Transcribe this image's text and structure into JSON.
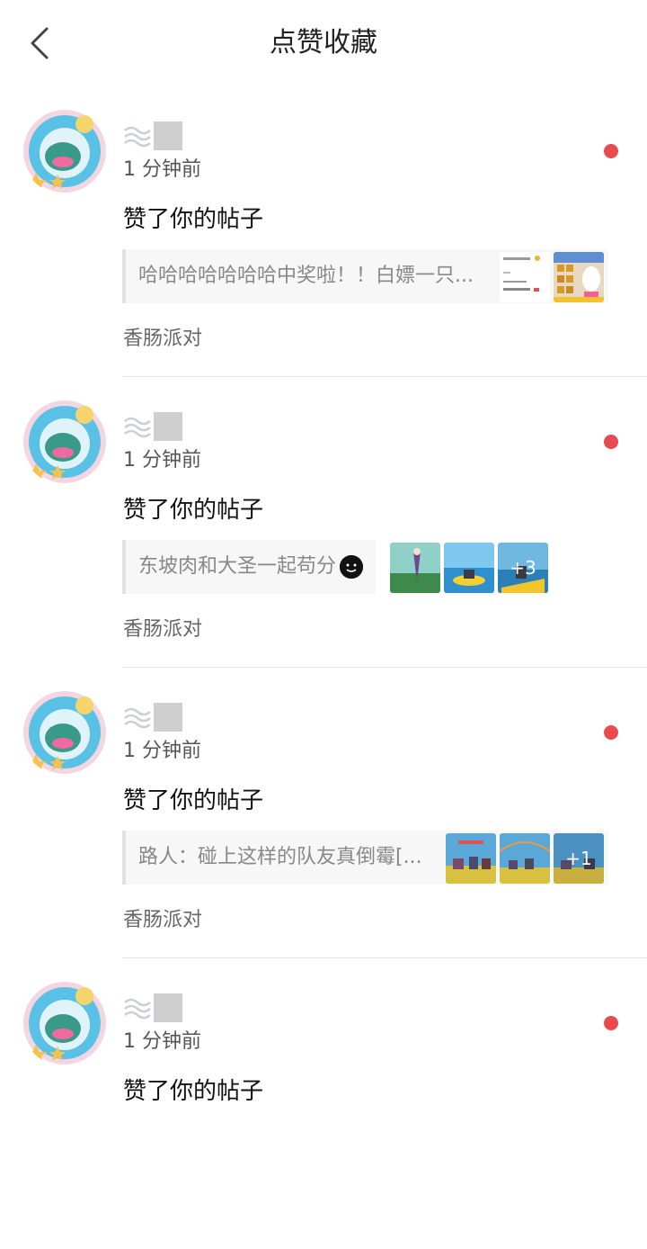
{
  "header": {
    "title": "点赞收藏",
    "back_icon": "chevron-left-icon"
  },
  "items": [
    {
      "time": "1 分钟前",
      "action": "赞了你的帖子",
      "quote": "哈哈哈哈哈哈哈中奖啦！！白嫖一只...",
      "tag": "香肠派对",
      "thumb_count": 2,
      "more": ""
    },
    {
      "time": "1 分钟前",
      "action": "赞了你的帖子",
      "quote": "东坡肉和大圣一起苟分",
      "tag": "香肠派对",
      "thumb_count": 3,
      "more": "+3"
    },
    {
      "time": "1 分钟前",
      "action": "赞了你的帖子",
      "quote": "路人：碰上这样的队友真倒霉[...",
      "tag": "香肠派对",
      "thumb_count": 3,
      "more": "+1"
    },
    {
      "time": "1 分钟前",
      "action": "赞了你的帖子"
    }
  ],
  "colors": {
    "unread_dot": "#e84a4f",
    "quote_bg": "#f7f7f7"
  }
}
